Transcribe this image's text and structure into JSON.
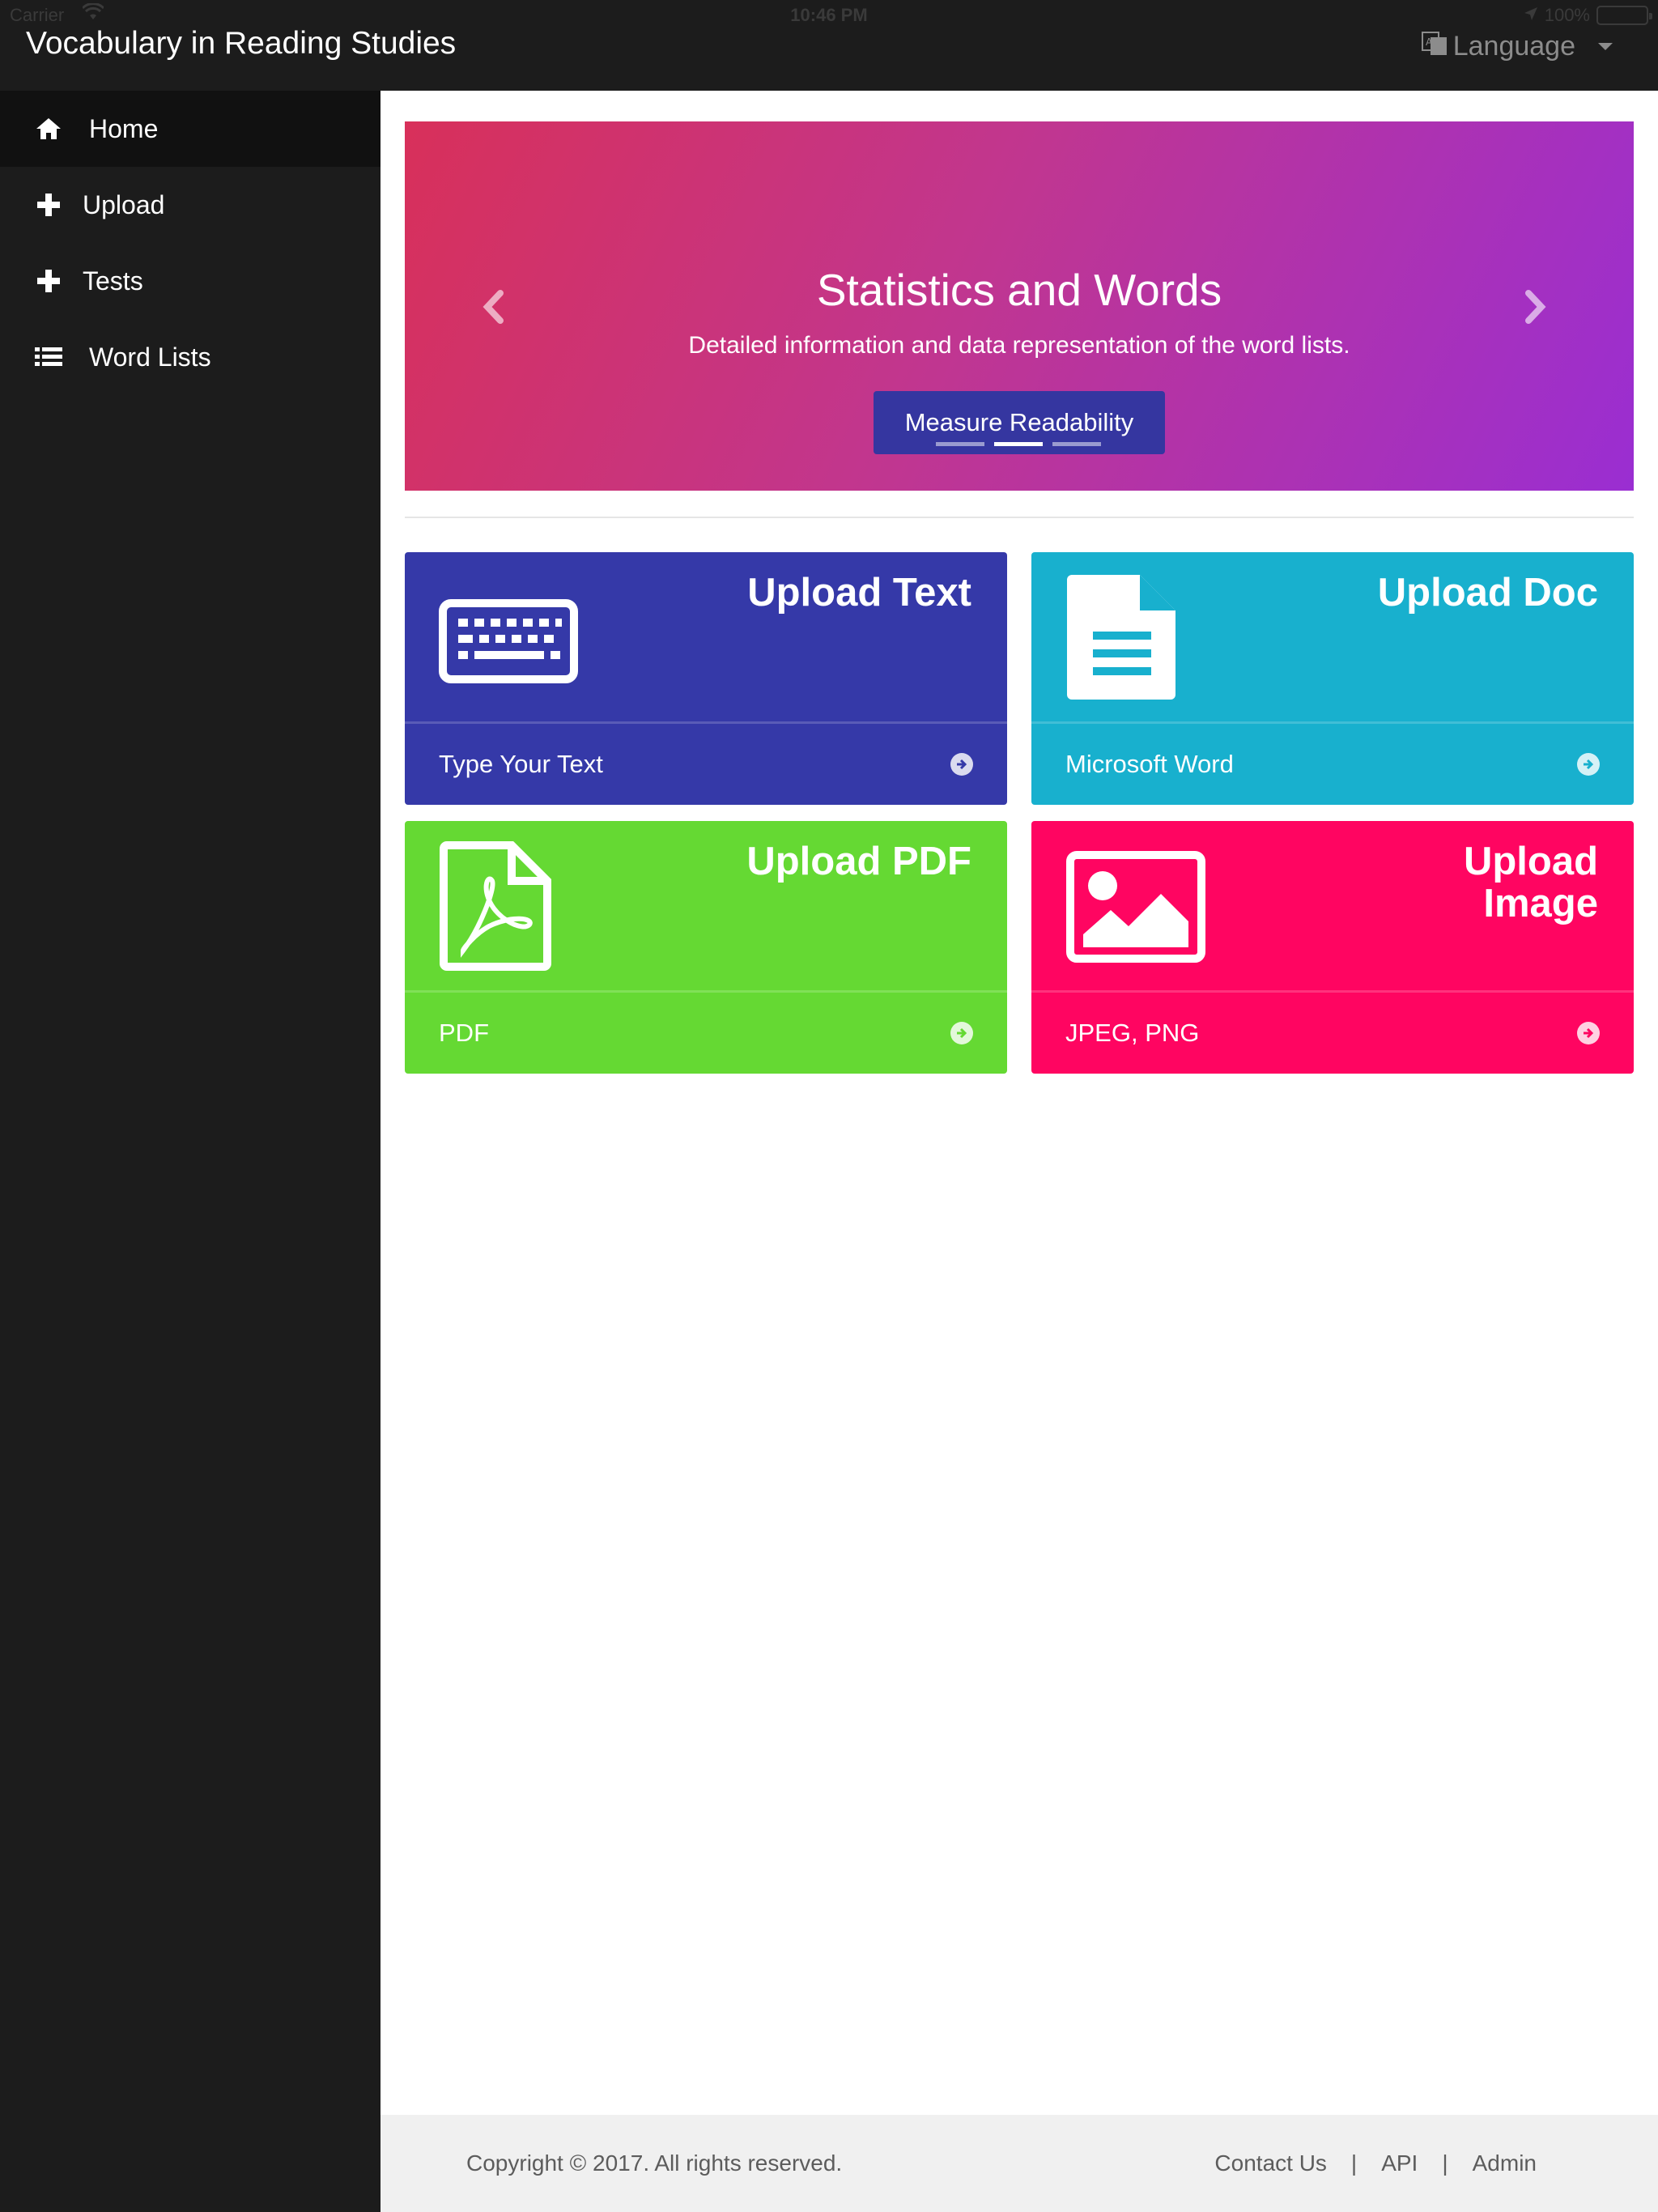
{
  "status_bar": {
    "carrier": "Carrier",
    "time": "10:46 PM",
    "battery": "100%"
  },
  "header": {
    "title": "Vocabulary in Reading Studies",
    "language_label": "Language"
  },
  "sidebar": {
    "items": [
      {
        "label": "Home",
        "icon": "home-icon",
        "active": true
      },
      {
        "label": "Upload",
        "icon": "plus-icon"
      },
      {
        "label": "Tests",
        "icon": "plus-icon"
      },
      {
        "label": "Word Lists",
        "icon": "list-icon"
      }
    ]
  },
  "carousel": {
    "title": "Statistics and Words",
    "subtitle": "Detailed information and data representation of the word lists.",
    "button_label": "Measure Readability",
    "slide_count": 3,
    "active_slide": 2,
    "gradient_colors": [
      "#d8305a",
      "#9a2ed2"
    ],
    "button_color": "#3536a0"
  },
  "tiles": [
    {
      "heading": "Upload Text",
      "footer": "Type Your Text",
      "icon": "keyboard-icon",
      "color": "#3539a8"
    },
    {
      "heading": "Upload Doc",
      "footer": "Microsoft Word",
      "icon": "document-icon",
      "color": "#18b0ce"
    },
    {
      "heading": "Upload PDF",
      "footer": "PDF",
      "icon": "pdf-icon",
      "color": "#65d933"
    },
    {
      "heading_line1": "Upload",
      "heading_line2": "Image",
      "footer": "JPEG, PNG",
      "icon": "image-icon",
      "color": "#ff0561"
    }
  ],
  "footer": {
    "copyright": "Copyright © 2017. All rights reserved.",
    "links": [
      "Contact Us",
      "API",
      "Admin"
    ],
    "separator": "|"
  }
}
